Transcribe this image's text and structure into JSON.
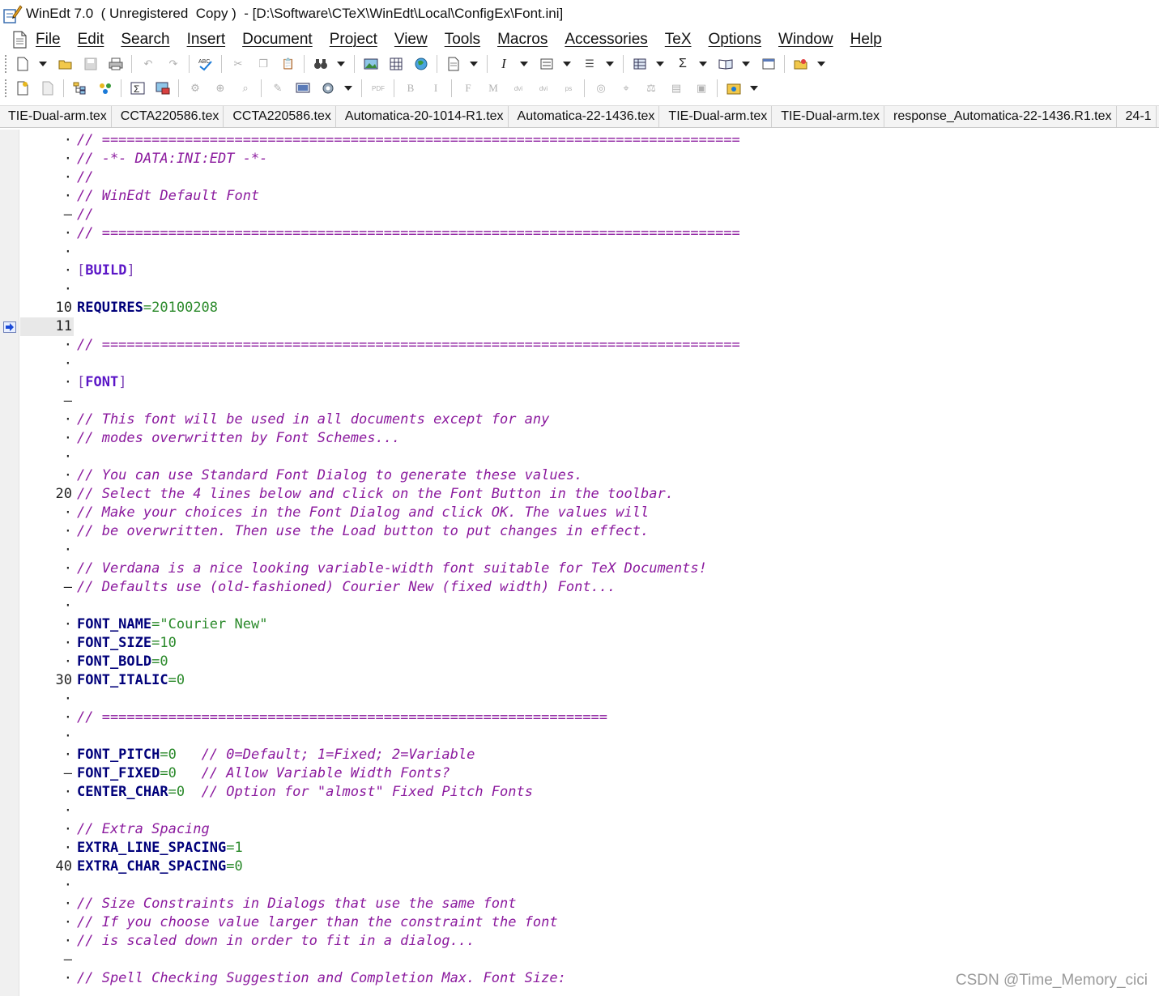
{
  "window": {
    "title": "WinEdt 7.0  ( Unregistered  Copy )  - [D:\\Software\\CTeX\\WinEdt\\Local\\ConfigEx\\Font.ini]",
    "app_icon": "winedt-pen-icon"
  },
  "menu": {
    "doc_icon": "document-icon",
    "items": [
      "File",
      "Edit",
      "Search",
      "Insert",
      "Document",
      "Project",
      "View",
      "Tools",
      "Macros",
      "Accessories",
      "TeX",
      "Options",
      "Window",
      "Help"
    ]
  },
  "toolbar1": {
    "buttons": [
      "new-icon",
      "new-dropdown",
      "open-icon",
      "save-icon",
      "print-icon",
      "undo-icon",
      "redo-icon",
      "spellcheck-icon",
      "cut-icon",
      "copy-icon",
      "paste-icon",
      "find-icon",
      "find-dropdown",
      "image-icon",
      "table-icon",
      "web-icon",
      "page-icon",
      "page-dropdown",
      "italic-icon",
      "italic-dropdown",
      "list-icon",
      "list-dropdown",
      "bullets-icon",
      "bullets-dropdown",
      "tabular-icon",
      "tabular-dropdown",
      "sigma-icon",
      "sigma-dropdown",
      "book-icon",
      "book-dropdown",
      "doc-icon",
      "folder-icon",
      "folder-dropdown"
    ]
  },
  "toolbar2": {
    "buttons": [
      "new-project-icon",
      "close-project-icon",
      "tree-icon",
      "gather-icon",
      "math-icon",
      "preview-icon",
      "macro-icon",
      "zoom-icon",
      "search-icon",
      "spell-icon",
      "screen-icon",
      "gear-icon",
      "gear-dropdown",
      "pdftex-icon",
      "bold-icon",
      "italic2-icon",
      "font-icon",
      "math2-icon",
      "dvi-pdf-icon",
      "dvi-ps-icon",
      "ps-pdf-icon",
      "dvi-view-icon",
      "dvi-search-icon",
      "bibtex-icon",
      "makeindex-icon",
      "acrobat-icon",
      "compile-icon",
      "compile-dropdown"
    ]
  },
  "tabs": [
    "TIE-Dual-arm.tex",
    "CCTA220586.tex",
    "CCTA220586.tex",
    "Automatica-20-1014-R1.tex",
    "Automatica-22-1436.tex",
    "TIE-Dual-arm.tex",
    "TIE-Dual-arm.tex",
    "response_Automatica-22-1436.R1.tex",
    "24-1"
  ],
  "gutter": [
    "·",
    "·",
    "·",
    "·",
    "–",
    "·",
    "·",
    "·",
    "·",
    "10",
    "11",
    "·",
    "·",
    "·",
    "–",
    "·",
    "·",
    "·",
    "·",
    "20",
    "·",
    "·",
    "·",
    "·",
    "–",
    "·",
    "·",
    "·",
    "·",
    "30",
    "·",
    "·",
    "·",
    "·",
    "–",
    "·",
    "·",
    "·",
    "·",
    "40",
    "·",
    "·",
    "·",
    "·",
    "–",
    "·"
  ],
  "current_line_index": 10,
  "code": [
    [
      {
        "c": "cm",
        "t": "// ============================================================================="
      }
    ],
    [
      {
        "c": "cm",
        "t": "// -*- DATA:INI:EDT -*-"
      }
    ],
    [
      {
        "c": "cm",
        "t": "//"
      }
    ],
    [
      {
        "c": "cm",
        "t": "// WinEdt Default Font"
      }
    ],
    [
      {
        "c": "cm",
        "t": "//"
      }
    ],
    [
      {
        "c": "cm",
        "t": "// ============================================================================="
      }
    ],
    [],
    [
      {
        "c": "sec-br",
        "t": "["
      },
      {
        "c": "sec",
        "t": "BUILD"
      },
      {
        "c": "sec-br",
        "t": "]"
      }
    ],
    [],
    [
      {
        "c": "key",
        "t": "REQUIRES"
      },
      {
        "c": "eq",
        "t": "="
      },
      {
        "c": "val",
        "t": "20100208"
      }
    ],
    [],
    [
      {
        "c": "cm",
        "t": "// ============================================================================="
      }
    ],
    [],
    [
      {
        "c": "sec-br",
        "t": "["
      },
      {
        "c": "sec",
        "t": "FONT"
      },
      {
        "c": "sec-br",
        "t": "]"
      }
    ],
    [],
    [
      {
        "c": "cm",
        "t": "// This font will be used in all documents except for any"
      }
    ],
    [
      {
        "c": "cm",
        "t": "// modes overwritten by Font Schemes..."
      }
    ],
    [],
    [
      {
        "c": "cm",
        "t": "// You can use Standard Font Dialog to generate these values."
      }
    ],
    [
      {
        "c": "cm",
        "t": "// Select the 4 lines below and click on the Font Button in the toolbar."
      }
    ],
    [
      {
        "c": "cm",
        "t": "// Make your choices in the Font Dialog and click OK. The values will"
      }
    ],
    [
      {
        "c": "cm",
        "t": "// be overwritten. Then use the Load button to put changes in effect."
      }
    ],
    [],
    [
      {
        "c": "cm",
        "t": "// Verdana is a nice looking variable-width font suitable for TeX Documents!"
      }
    ],
    [
      {
        "c": "cm",
        "t": "// Defaults use (old-fashioned) Courier New (fixed width) Font..."
      }
    ],
    [],
    [
      {
        "c": "key",
        "t": "FONT_NAME"
      },
      {
        "c": "eq",
        "t": "=\""
      },
      {
        "c": "val",
        "t": "Courier New"
      },
      {
        "c": "eq",
        "t": "\""
      }
    ],
    [
      {
        "c": "key",
        "t": "FONT_SIZE"
      },
      {
        "c": "eq",
        "t": "="
      },
      {
        "c": "val",
        "t": "10"
      }
    ],
    [
      {
        "c": "key",
        "t": "FONT_BOLD"
      },
      {
        "c": "eq",
        "t": "="
      },
      {
        "c": "val",
        "t": "0"
      }
    ],
    [
      {
        "c": "key",
        "t": "FONT_ITALIC"
      },
      {
        "c": "eq",
        "t": "="
      },
      {
        "c": "val",
        "t": "0"
      }
    ],
    [],
    [
      {
        "c": "cm",
        "t": "// ============================================================="
      }
    ],
    [],
    [
      {
        "c": "key",
        "t": "FONT_PITCH"
      },
      {
        "c": "eq",
        "t": "="
      },
      {
        "c": "val",
        "t": "0   "
      },
      {
        "c": "cm",
        "t": "// 0=Default; 1=Fixed; 2=Variable"
      }
    ],
    [
      {
        "c": "key",
        "t": "FONT_FIXED"
      },
      {
        "c": "eq",
        "t": "="
      },
      {
        "c": "val",
        "t": "0   "
      },
      {
        "c": "cm",
        "t": "// Allow Variable Width Fonts?"
      }
    ],
    [
      {
        "c": "key",
        "t": "CENTER_CHAR"
      },
      {
        "c": "eq",
        "t": "="
      },
      {
        "c": "val",
        "t": "0  "
      },
      {
        "c": "cm",
        "t": "// Option for \"almost\" Fixed Pitch Fonts"
      }
    ],
    [],
    [
      {
        "c": "cm",
        "t": "// Extra Spacing"
      }
    ],
    [
      {
        "c": "key",
        "t": "EXTRA_LINE_SPACING"
      },
      {
        "c": "eq",
        "t": "="
      },
      {
        "c": "val",
        "t": "1"
      }
    ],
    [
      {
        "c": "key",
        "t": "EXTRA_CHAR_SPACING"
      },
      {
        "c": "eq",
        "t": "="
      },
      {
        "c": "val",
        "t": "0"
      }
    ],
    [],
    [
      {
        "c": "cm",
        "t": "// Size Constraints in Dialogs that use the same font"
      }
    ],
    [
      {
        "c": "cm",
        "t": "// If you choose value larger than the constraint the font"
      }
    ],
    [
      {
        "c": "cm",
        "t": "// is scaled down in order to fit in a dialog..."
      }
    ],
    [],
    [
      {
        "c": "cm",
        "t": "// Spell Checking Suggestion and Completion Max. Font Size:"
      }
    ]
  ],
  "watermark": "CSDN @Time_Memory_cici",
  "colors": {
    "comment": "#8b1a9e",
    "key": "#00007a",
    "value": "#2b8a2b",
    "section": "#5b16c7"
  }
}
